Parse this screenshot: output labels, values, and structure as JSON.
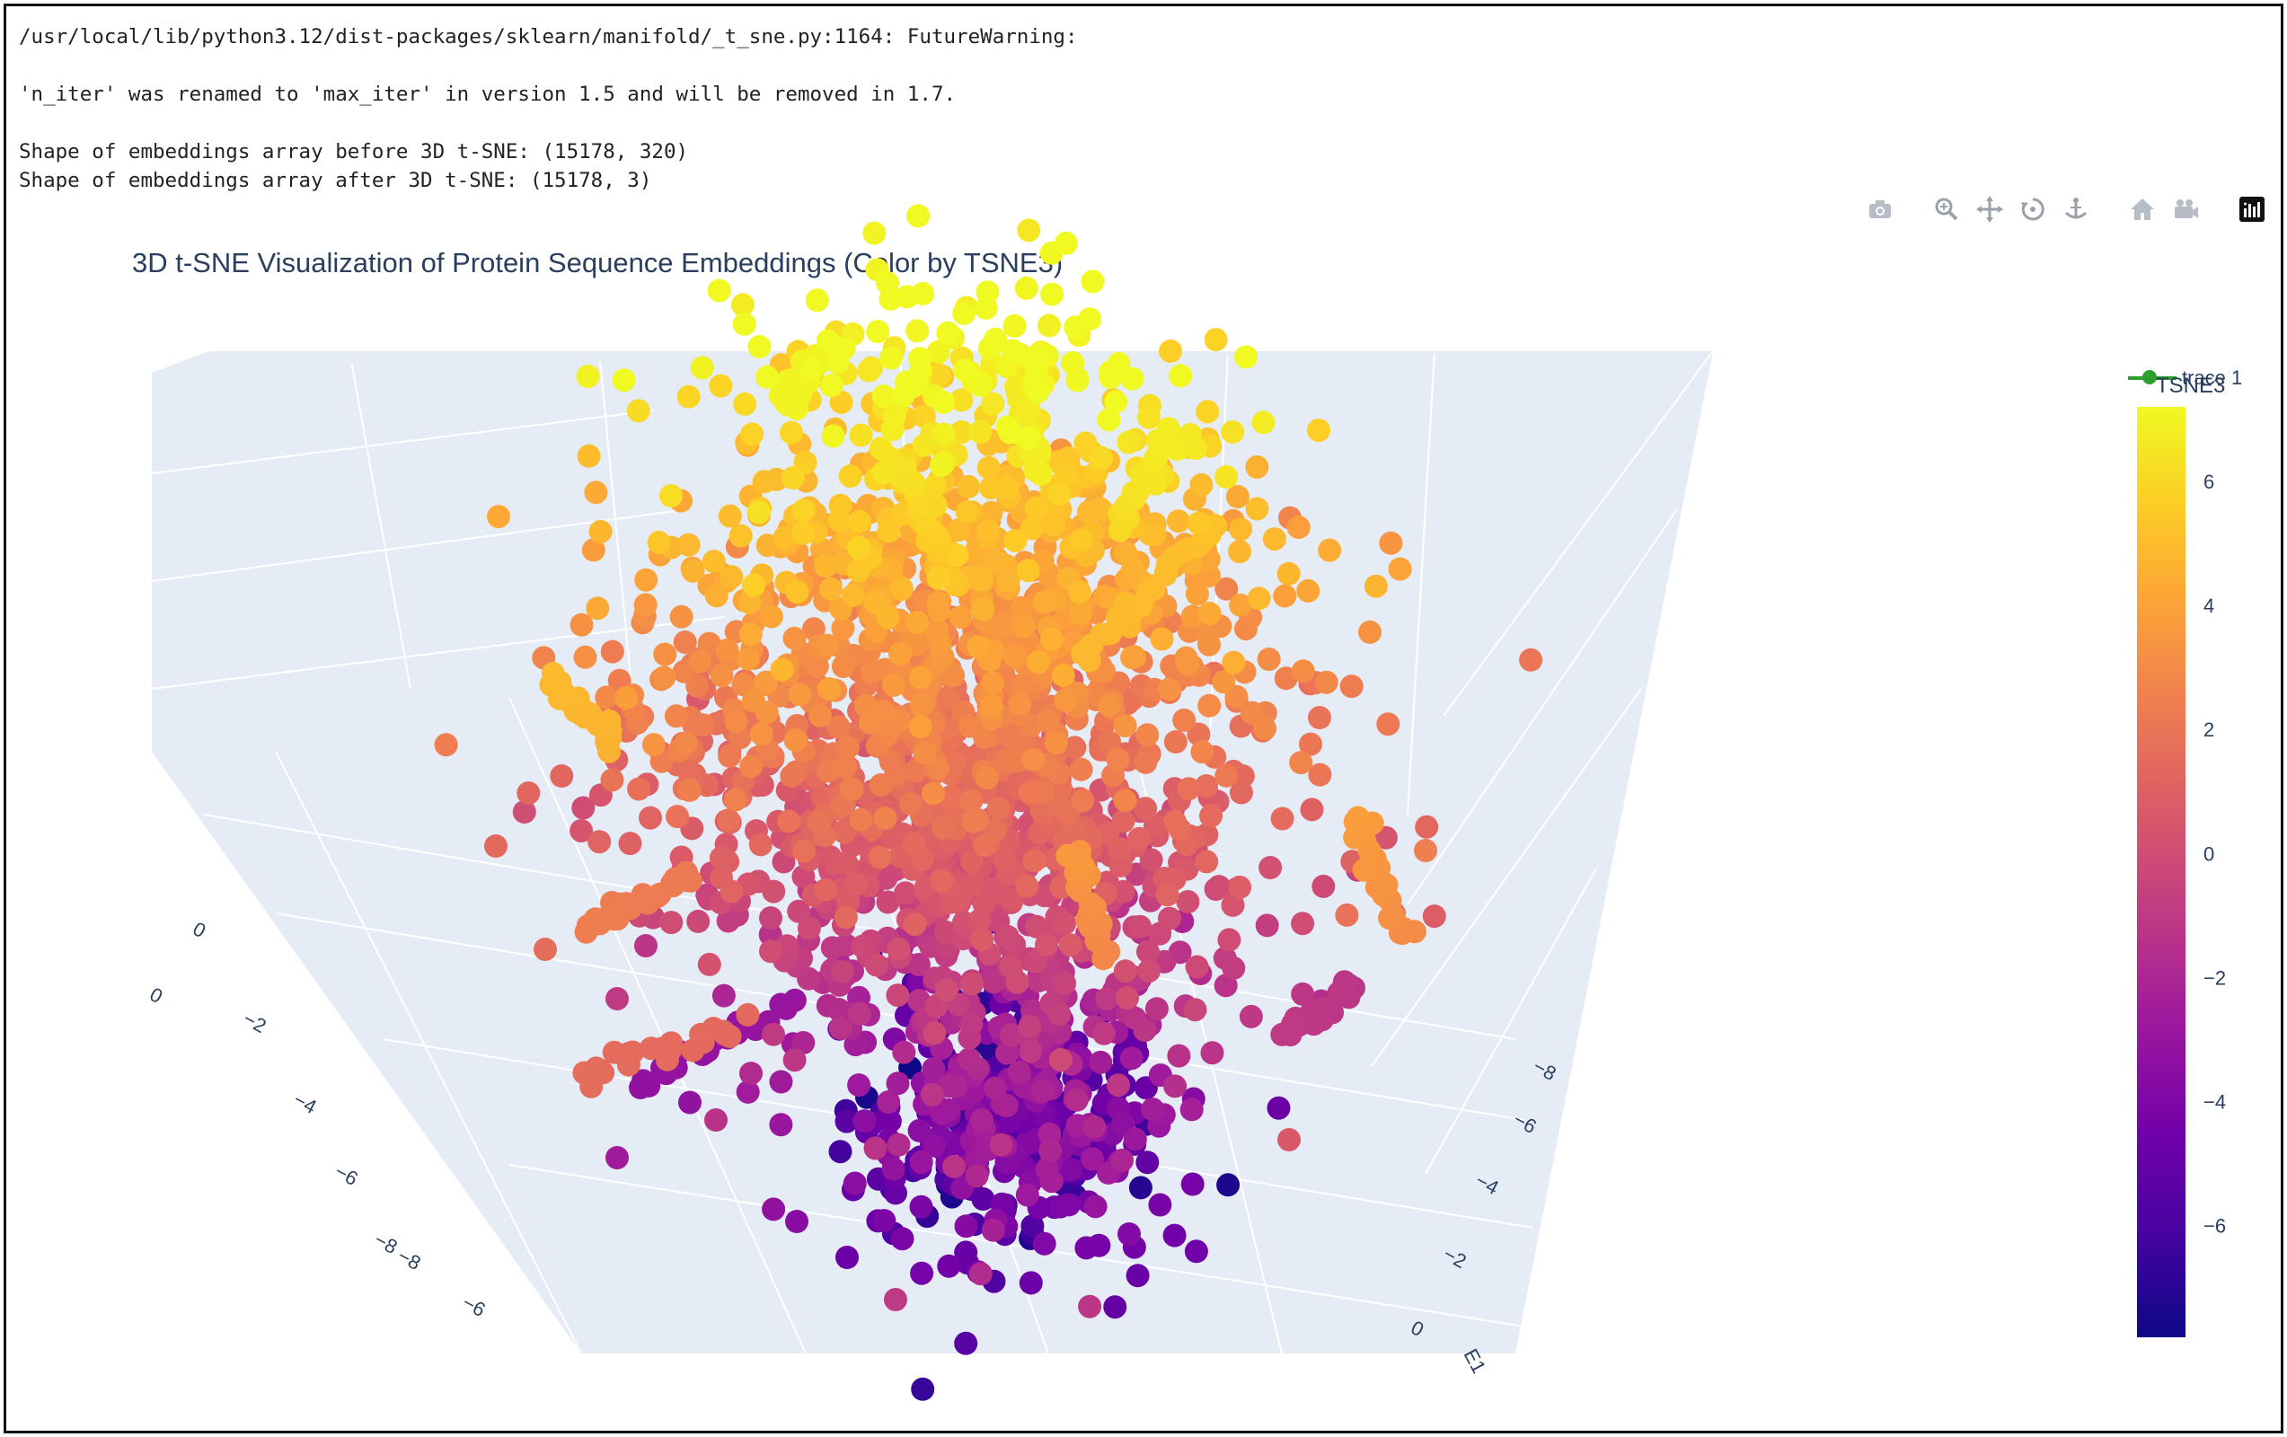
{
  "console": {
    "lines": [
      "/usr/local/lib/python3.12/dist-packages/sklearn/manifold/_t_sne.py:1164: FutureWarning:",
      "",
      "'n_iter' was renamed to 'max_iter' in version 1.5 and will be removed in 1.7.",
      "",
      "Shape of embeddings array before 3D t-SNE: (15178, 320)",
      "Shape of embeddings array after 3D t-SNE: (15178, 3)"
    ]
  },
  "modebar": {
    "buttons": [
      {
        "name": "camera-icon",
        "label": "Download plot as a png"
      },
      {
        "name": "zoom-icon",
        "label": "Zoom"
      },
      {
        "name": "pan-icon",
        "label": "Pan"
      },
      {
        "name": "orbit-rotation-icon",
        "label": "Orbital rotation"
      },
      {
        "name": "turntable-rotation-icon",
        "label": "Turntable rotation"
      },
      {
        "name": "home-icon",
        "label": "Reset camera to default"
      },
      {
        "name": "camera-video-icon",
        "label": "Reset camera to last save"
      },
      {
        "name": "plotly-logo-icon",
        "label": "Produced with Plotly.js"
      }
    ]
  },
  "chart_data": {
    "type": "scatter3d",
    "title": "3D t-SNE Visualization of Protein Sequence Embeddings (Color by TSNE3)",
    "legend": {
      "entries": [
        "trace 1"
      ],
      "placement": "top-right",
      "trace_color": "#2ca02c"
    },
    "colorbar": {
      "title": "TSNE3",
      "colorscale": "Plasma",
      "colors": [
        "#0d0887",
        "#46039f",
        "#7201a8",
        "#9c179e",
        "#bd3786",
        "#d8576b",
        "#ed7953",
        "#fb9f3a",
        "#fdca26",
        "#f0f921"
      ],
      "range": [
        -7.8,
        7.2
      ],
      "ticks": [
        6,
        4,
        2,
        0,
        -2,
        -4,
        -6
      ],
      "tick_labels": [
        "6",
        "4",
        "2",
        "0",
        "−2",
        "−4",
        "−6"
      ]
    },
    "axes": {
      "left_axis_tick_labels": [
        "0",
        "−2",
        "−4",
        "−6",
        "−8"
      ],
      "left_axis_partial_label": "0",
      "front_axis_tick_labels": [
        "−8",
        "−6"
      ],
      "right_axis_tick_labels": [
        "−8",
        "−6",
        "−4",
        "−2",
        "0"
      ],
      "right_axis_title_partial": "E1",
      "scene_background": "#e5ecf6",
      "grid": true
    },
    "point_count": 15178
  }
}
